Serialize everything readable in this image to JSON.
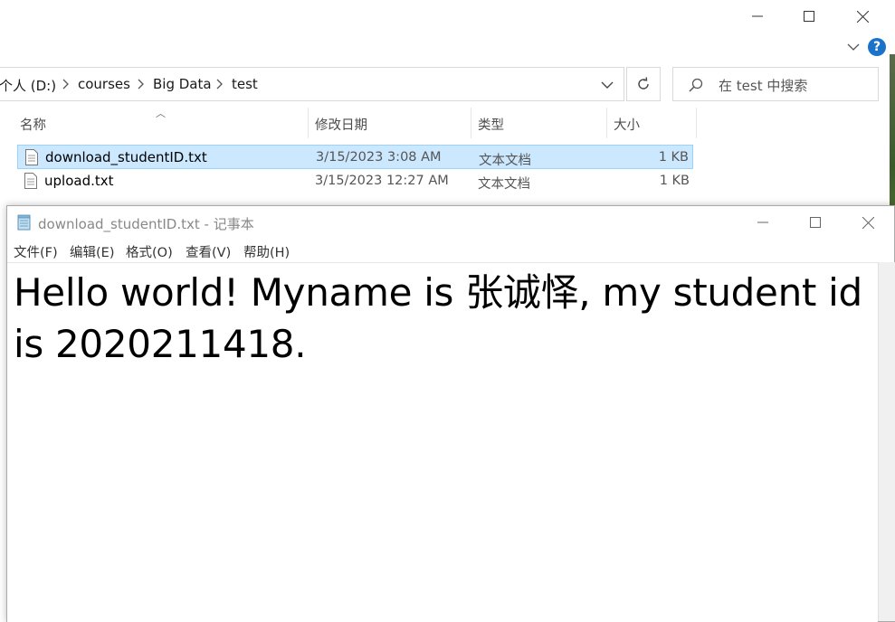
{
  "explorer": {
    "breadcrumbs": [
      "个人 (D:)",
      "courses",
      "Big Data",
      "test"
    ],
    "search_placeholder": "在 test 中搜索",
    "columns": {
      "name": "名称",
      "date": "修改日期",
      "type": "类型",
      "size": "大小"
    },
    "files": [
      {
        "name": "download_studentID.txt",
        "date": "3/15/2023 3:08 AM",
        "type": "文本文档",
        "size": "1 KB",
        "selected": true
      },
      {
        "name": "upload.txt",
        "date": "3/15/2023 12:27 AM",
        "type": "文本文档",
        "size": "1 KB",
        "selected": false
      }
    ],
    "icons": [
      "minimize-icon",
      "maximize-icon",
      "close-icon",
      "chevron-down-icon",
      "help-icon",
      "refresh-icon",
      "search-icon",
      "text-file-icon"
    ],
    "accent": "#cce8ff",
    "help_color": "#1a73c8",
    "help_symbol": "?"
  },
  "notepad": {
    "title": "download_studentID.txt - 记事本",
    "menu": [
      "文件(F)",
      "编辑(E)",
      "格式(O)",
      "查看(V)",
      "帮助(H)"
    ],
    "content": "Hello world! Myname is 张诚怿, my student id is 2020211418."
  }
}
